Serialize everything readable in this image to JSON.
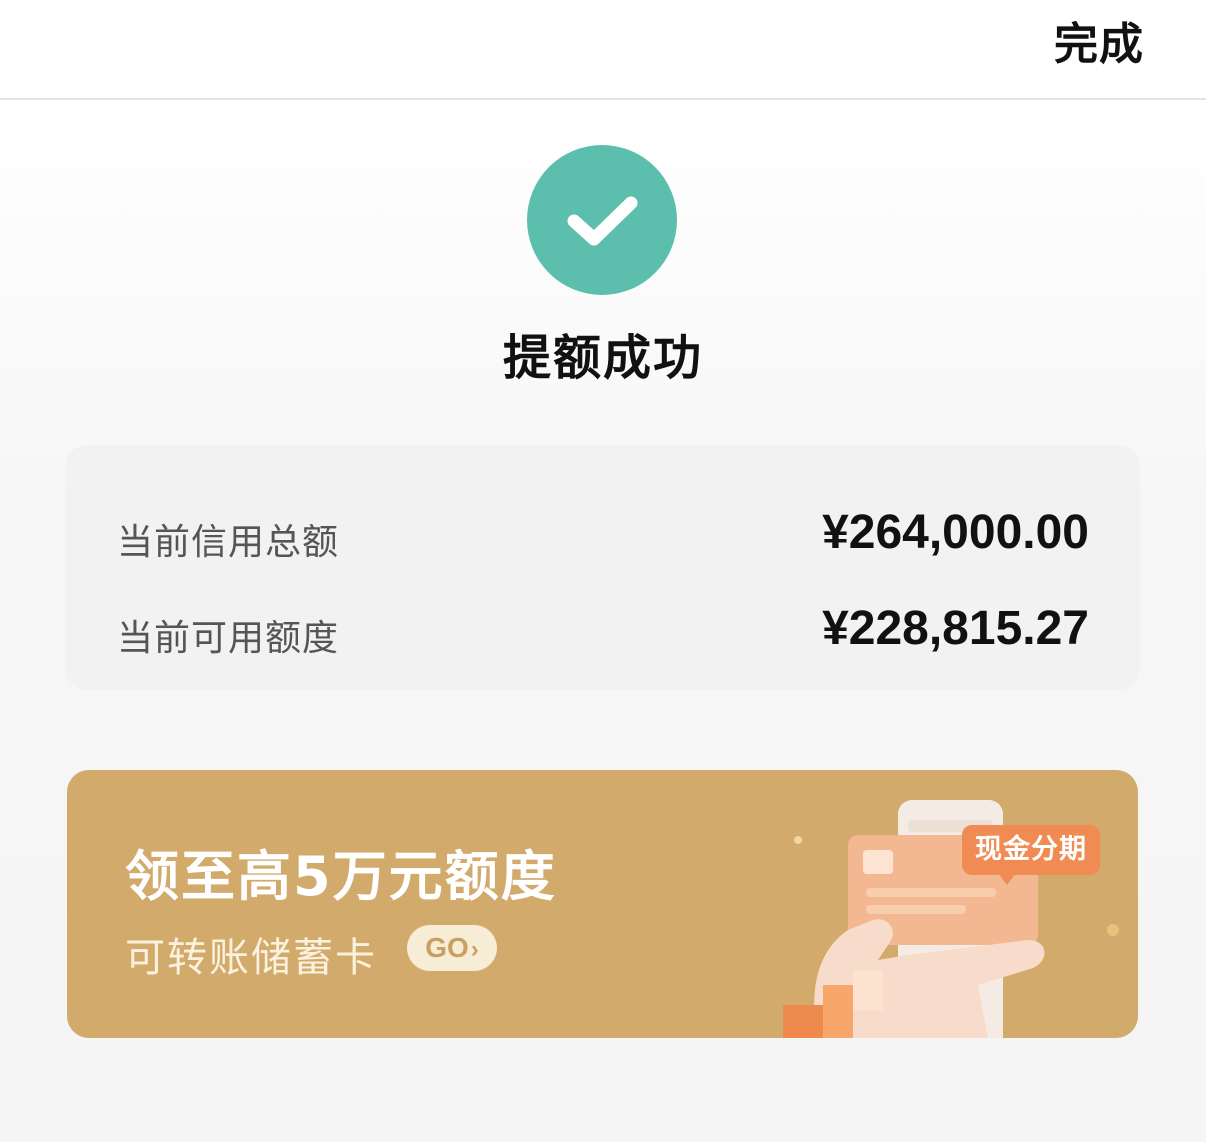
{
  "header": {
    "done_label": "完成"
  },
  "status": {
    "icon": "check-icon",
    "title": "提额成功",
    "color": "#5cbfae"
  },
  "credit": {
    "total_label": "当前信用总额",
    "total_value": "¥264,000.00",
    "available_label": "当前可用额度",
    "available_value": "¥228,815.27"
  },
  "promo": {
    "title": "领至高5万元额度",
    "subtitle": "可转账储蓄卡",
    "go_label": "GO",
    "go_icon": "chevron-right-icon",
    "tag": "现金分期",
    "background": "#d2aa6b"
  }
}
